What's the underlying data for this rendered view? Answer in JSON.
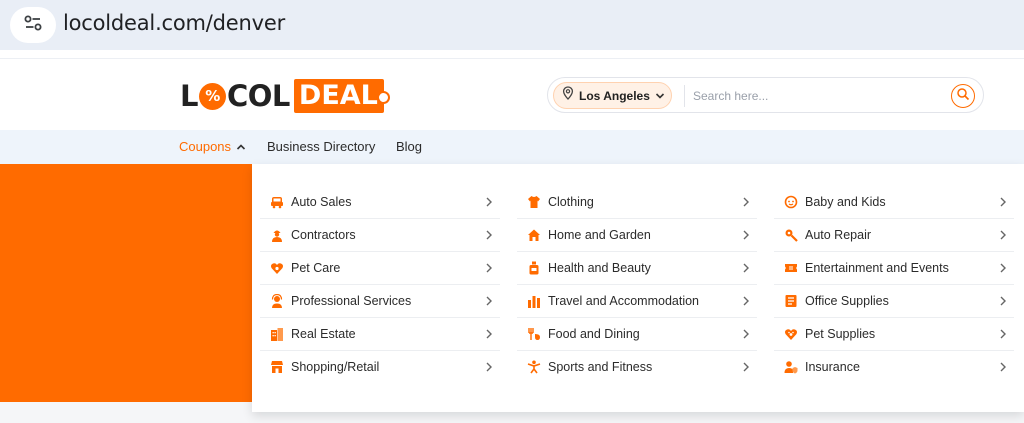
{
  "browser": {
    "url": "locoldeal.com/denver"
  },
  "logo": {
    "part1a": "L",
    "o_mark": "%",
    "part1b": "COL",
    "part2": "DEAL"
  },
  "search": {
    "location": "Los Angeles",
    "placeholder": "Search here..."
  },
  "nav": {
    "coupons": "Coupons",
    "business_directory": "Business Directory",
    "blog": "Blog"
  },
  "colors": {
    "accent": "#ff6b00",
    "nav_bg": "#eef4fb"
  },
  "categories": {
    "col1": [
      {
        "label": "Auto Sales",
        "icon": "car-icon"
      },
      {
        "label": "Contractors",
        "icon": "worker-icon"
      },
      {
        "label": "Pet Care",
        "icon": "pet-heart-icon"
      },
      {
        "label": "Professional Services",
        "icon": "support-agent-icon"
      },
      {
        "label": "Real Estate",
        "icon": "building-icon"
      },
      {
        "label": "Shopping/Retail",
        "icon": "store-icon"
      }
    ],
    "col2": [
      {
        "label": "Clothing",
        "icon": "shirt-icon"
      },
      {
        "label": "Home and Garden",
        "icon": "house-icon"
      },
      {
        "label": "Health and Beauty",
        "icon": "beauty-bottle-icon"
      },
      {
        "label": "Travel and Accommodation",
        "icon": "luggage-icon"
      },
      {
        "label": "Food and Dining",
        "icon": "food-icon"
      },
      {
        "label": "Sports and Fitness",
        "icon": "fitness-icon"
      }
    ],
    "col3": [
      {
        "label": "Baby and Kids",
        "icon": "baby-icon"
      },
      {
        "label": "Auto Repair",
        "icon": "wrench-gear-icon"
      },
      {
        "label": "Entertainment and Events",
        "icon": "ticket-icon"
      },
      {
        "label": "Office Supplies",
        "icon": "office-icon"
      },
      {
        "label": "Pet Supplies",
        "icon": "paw-heart-icon"
      },
      {
        "label": "Insurance",
        "icon": "person-shield-icon"
      }
    ]
  }
}
